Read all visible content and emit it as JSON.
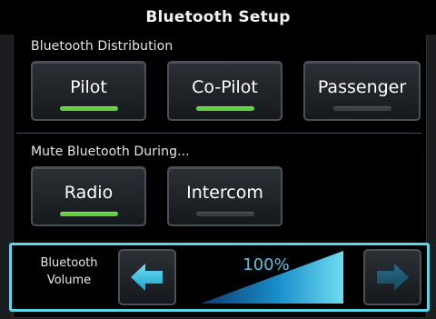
{
  "header": {
    "title": "Bluetooth Setup"
  },
  "distribution": {
    "label": "Bluetooth Distribution",
    "buttons": [
      {
        "label": "Pilot",
        "active": true
      },
      {
        "label": "Co-Pilot",
        "active": true
      },
      {
        "label": "Passenger",
        "active": false
      }
    ]
  },
  "mute": {
    "label": "Mute Bluetooth During...",
    "buttons": [
      {
        "label": "Radio",
        "active": true
      },
      {
        "label": "Intercom",
        "active": false
      }
    ]
  },
  "volume": {
    "label_line1": "Bluetooth",
    "label_line2": "Volume",
    "value_text": "100%",
    "level": 1.0,
    "decrease_icon": "arrow-left-icon",
    "increase_icon": "arrow-right-icon"
  },
  "colors": {
    "annunciator_on": "#5ed03a",
    "annunciator_off": "#3c3f42",
    "accent_cyan": "#5ad6e9",
    "background": "#000000"
  }
}
